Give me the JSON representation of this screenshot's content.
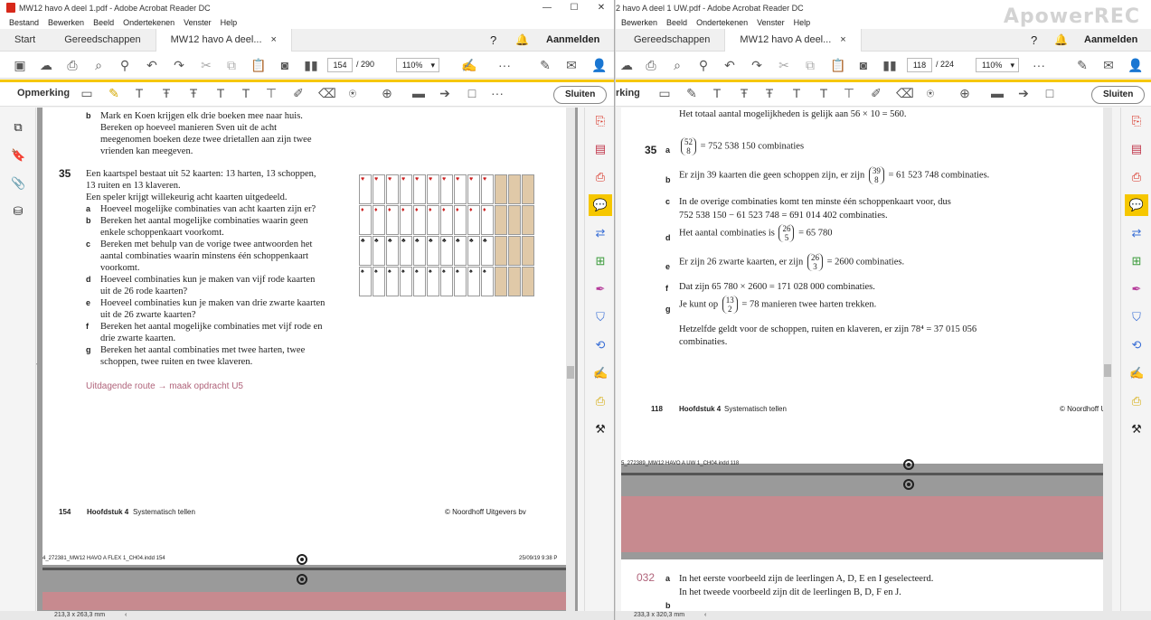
{
  "watermark": "ApowerREC",
  "left": {
    "title": "MW12 havo A deel 1.pdf - Adobe Acrobat Reader DC",
    "menu": [
      "Bestand",
      "Bewerken",
      "Beeld",
      "Ondertekenen",
      "Venster",
      "Help"
    ],
    "tabs": {
      "start": "Start",
      "tools": "Gereedschappen",
      "doc": "MW12 havo A deel...",
      "close": "×"
    },
    "signin": "Aanmelden",
    "page_current": "154",
    "page_total": "/ 290",
    "zoom": "110%",
    "comment_label": "Opmerking",
    "close_button": "Sluiten",
    "status": "213,3 x 263,3 mm",
    "content": {
      "b_intro": [
        "Mark en Koen krijgen elk drie boeken mee naar huis.",
        "Bereken op hoeveel manieren Sven uit de acht",
        "meegenomen boeken deze twee drietallen aan zijn twee",
        "vrienden kan meegeven."
      ],
      "q35": "35",
      "intro": [
        "Een kaartspel bestaat uit 52 kaarten: 13 harten, 13 schoppen,",
        "13 ruiten en 13 klaveren.",
        "Een speler krijgt willekeurig acht kaarten uitgedeeld."
      ],
      "items": [
        {
          "l": "a",
          "t": [
            "Hoeveel mogelijke combinaties van acht kaarten zijn er?"
          ]
        },
        {
          "l": "b",
          "t": [
            "Bereken het aantal mogelijke combinaties waarin geen",
            "enkele schoppenkaart voorkomt."
          ]
        },
        {
          "l": "c",
          "t": [
            "Bereken met behulp van de vorige twee antwoorden het",
            "aantal combinaties waarin minstens één schoppenkaart",
            "voorkomt."
          ]
        },
        {
          "l": "d",
          "t": [
            "Hoeveel combinaties kun je maken van vijf rode kaarten",
            "uit de 26 rode kaarten?"
          ]
        },
        {
          "l": "e",
          "t": [
            "Hoeveel combinaties kun je maken van drie zwarte kaarten",
            "uit de 26 zwarte kaarten?"
          ]
        },
        {
          "l": "f",
          "t": [
            "Bereken het aantal mogelijke combinaties met vijf rode en",
            "drie zwarte kaarten."
          ]
        },
        {
          "l": "g",
          "t": [
            "Bereken het aantal combinaties met twee harten, twee",
            "schoppen, twee ruiten en twee klaveren."
          ]
        }
      ],
      "route": "Uitdagende route → maak opdracht U5",
      "footer_num": "154",
      "footer_chapter": "Hoofdstuk 4",
      "footer_topic": "Systematisch tellen",
      "footer_copy": "© Noordhoff Uitgevers bv",
      "slug": "4_272381_MW12 HAVO A FLEX 1_CH04.indd   154",
      "slug_date": "25/09/19   9:38 P"
    }
  },
  "right": {
    "title": "2 havo A deel 1 UW.pdf - Adobe Acrobat Reader DC",
    "menu": [
      "Bewerken",
      "Beeld",
      "Ondertekenen",
      "Venster",
      "Help"
    ],
    "tabs": {
      "tools": "Gereedschappen",
      "doc": "MW12 havo A deel...",
      "close": "×"
    },
    "signin": "Aanmelden",
    "page_current": "118",
    "page_total": "/ 224",
    "zoom": "110%",
    "comment_label": "rking",
    "close_button": "Sluiten",
    "status": "233,3 x 320,3 mm",
    "content": {
      "top": "Het totaal aantal mogelijkheden is gelijk aan 56 × 10 = 560.",
      "q35": "35",
      "a_text": "= 752 538 150 combinaties",
      "a_binom": [
        "52",
        "8"
      ],
      "b_text1": "Er zijn 39 kaarten die geen schoppen zijn, er zijn",
      "b_binom": [
        "39",
        "8"
      ],
      "b_text2": "= 61 523 748 combinaties.",
      "c_text": [
        "In de overige combinaties komt ten minste één schoppenkaart voor, dus",
        "752 538 150 − 61 523 748 = 691 014 402 combinaties."
      ],
      "d_text1": "Het aantal combinaties is",
      "d_binom": [
        "26",
        "5"
      ],
      "d_text2": "= 65 780",
      "e_text1": "Er zijn 26 zwarte kaarten, er zijn",
      "e_binom": [
        "26",
        "3"
      ],
      "e_text2": "= 2600 combinaties.",
      "f_text": "Dat zijn 65 780 × 2600 = 171 028 000 combinaties.",
      "g_text1": "Je kunt op",
      "g_binom": [
        "13",
        "2"
      ],
      "g_text2": "= 78 manieren twee harten trekken.",
      "g_extra": [
        "Hetzelfde geldt voor de schoppen, ruiten en klaveren, er zijn 78⁴ = 37 015 056",
        "combinaties."
      ],
      "footer_num": "118",
      "footer_chapter": "Hoofdstuk 4",
      "footer_topic": "Systematisch tellen",
      "footer_copy": "© Noordhoff U",
      "slug": "5_272389_MW12 HAVO A UW 1_CH04.indd   118",
      "q32": "032",
      "q32_a": [
        "In het eerste voorbeeld zijn de leerlingen A, D, E en I geselecteerd.",
        "In het tweede voorbeeld zijn dit de leerlingen B, D, F en J."
      ],
      "q32_b": "b"
    }
  },
  "letters": {
    "a": "a",
    "b": "b",
    "c": "c",
    "d": "d",
    "e": "e",
    "f": "f",
    "g": "g"
  },
  "colors": {
    "accent_yellow": "#f6c700",
    "pink_band": "#c78a8f",
    "route_pink": "#b0637a",
    "pdf_red": "#d7281a"
  }
}
